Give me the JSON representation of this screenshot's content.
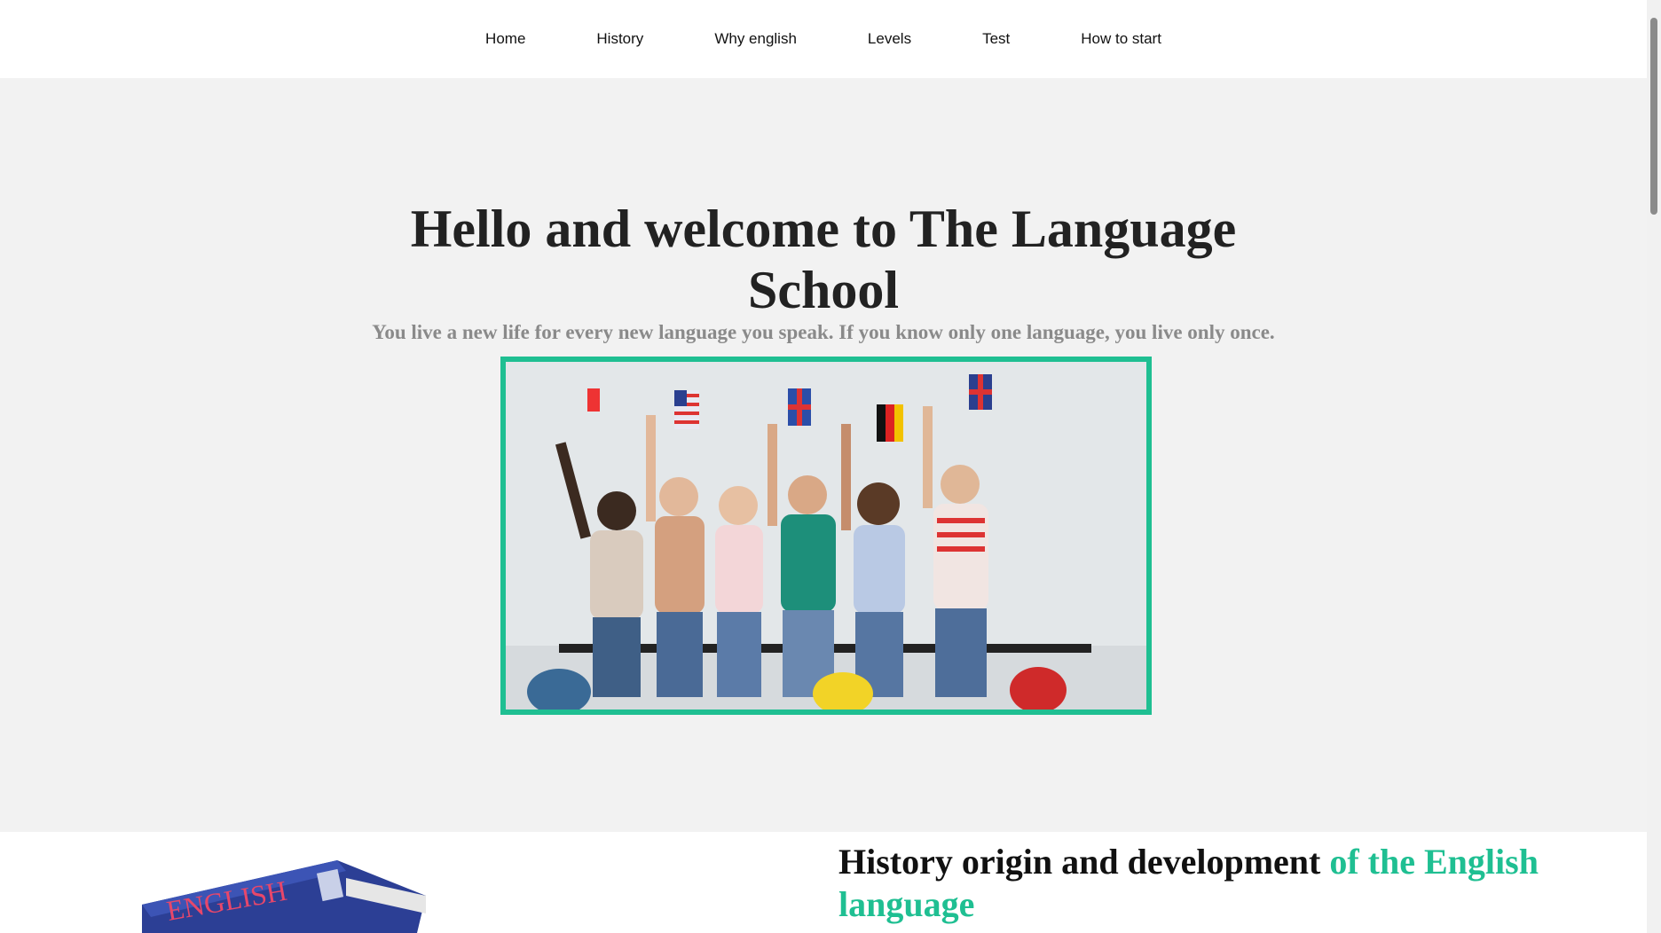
{
  "nav": {
    "items": [
      {
        "label": "Home"
      },
      {
        "label": "History"
      },
      {
        "label": "Why english"
      },
      {
        "label": "Levels"
      },
      {
        "label": "Test"
      },
      {
        "label": "How to start"
      }
    ]
  },
  "hero": {
    "title": "Hello and welcome to The Language School",
    "quote": "You live a new life for every new language you speak. If you know only one language, you live only once."
  },
  "history": {
    "title_main": "History origin and development",
    "title_accent": "of the English language",
    "book_label": "ENGLISH"
  },
  "colors": {
    "accent": "#1fbf92",
    "hero_bg": "#f2f2f2"
  }
}
